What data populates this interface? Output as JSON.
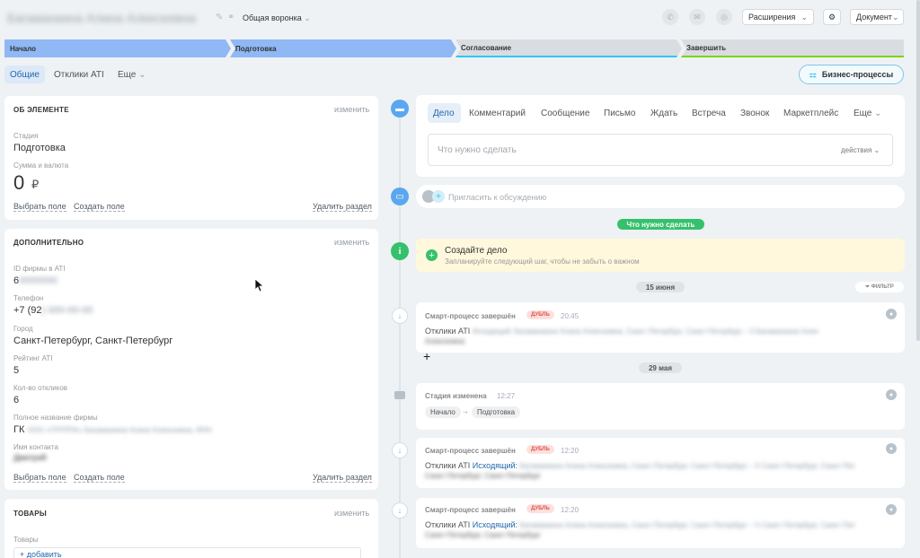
{
  "header": {
    "title": "Багаманкина Алина Алексеевна",
    "pipeline": "Общая воронка",
    "ext_btn": "Расширения",
    "doc_btn": "Документ"
  },
  "stages": [
    "Начало",
    "Подготовка",
    "Согласование",
    "Завершить"
  ],
  "tabs": {
    "general": "Общие",
    "ati": "Отклики ATI",
    "more": "Еще"
  },
  "bp_btn": "Бизнес-процессы",
  "about": {
    "title": "ОБ ЭЛЕМЕНТЕ",
    "change": "изменить",
    "stage_label": "Стадия",
    "stage_value": "Подготовка",
    "sum_label": "Сумма и валюта",
    "sum_value": "0",
    "currency": "₽",
    "pick": "Выбрать поле",
    "create": "Создать поле",
    "delete": "Удалить раздел"
  },
  "extra": {
    "title": "ДОПОЛНИТЕЛЬНО",
    "change": "изменить",
    "f1_label": "ID фирмы в ATI",
    "f1_value": "6",
    "f1_blur": "0000000",
    "f2_label": "Телефон",
    "f2_value": "+7 (92",
    "f2_blur": ") 000-00-00",
    "f3_label": "Город",
    "f3_value": "Санкт-Петербург, Санкт-Петербург",
    "f4_label": "Рейтинг ATI",
    "f4_value": "5",
    "f5_label": "Кол-во откликов",
    "f5_value": "6",
    "f6_label": "Полное название фирмы",
    "f6_value": "ГК",
    "f6_blur": "ООО «ГРУППА» Багаманкина Алина Алексеевна, ИНН",
    "f7_label": "Имя контакта",
    "f7_blur": "Дмитрий",
    "pick": "Выбрать поле",
    "create": "Создать поле",
    "delete": "Удалить раздел"
  },
  "goods": {
    "title": "ТОВАРЫ",
    "change": "изменить",
    "label": "Товары",
    "add": "+ добавить"
  },
  "composer": {
    "tabs": [
      "Дело",
      "Комментарий",
      "Сообщение",
      "Письмо",
      "Ждать",
      "Встреча",
      "Звонок",
      "Маркетплейс",
      "Еще"
    ],
    "placeholder": "Что нужно сделать",
    "actions": "действия"
  },
  "invite": "Пригласить к обсуждению",
  "todo_pill": "Что нужно сделать",
  "create_task": {
    "title": "Создайте дело",
    "sub": "Запланируйте следующий шаг, чтобы не забыть о важном"
  },
  "date1": "15 июня",
  "filter": "ФИЛЬТР",
  "date2": "29 мая",
  "events": {
    "e1": {
      "title": "Смарт-процесс завершён",
      "badge": "ДУБЛЬ",
      "time": "20:45",
      "text": "Отклики ATI",
      "blur1": "Исходящий: Багаманкина Алина Алексеевна, Санкт-Петербург, Санкт-Петербург – 5 Багаманкина Ален",
      "blur2": "Алексеевна"
    },
    "e2": {
      "title": "Стадия изменена",
      "time": "12:27",
      "from": "Начало",
      "to": "Подготовка"
    },
    "e3": {
      "title": "Смарт-процесс завершён",
      "badge": "ДУБЛЬ",
      "time": "12:20",
      "text": "Отклики ATI",
      "link": "Исходящий:",
      "blur1": "Багаманкина Алина Алексеевна, Санкт-Петербург, Санкт-Петербург – 5 Санкт-Петербург, Санкт-Пет",
      "blur2": "Санкт-Петербург, Санкт-Петербург"
    },
    "e4": {
      "title": "Смарт-процесс завершён",
      "badge": "ДУБЛЬ",
      "time": "12:20",
      "text": "Отклики ATI",
      "link": "Исходящий:",
      "blur1": "Багаманкина Алина Алексеевна, Санкт-Петербург, Санкт-Петербург – 5 Санкт-Петербург, Санкт-Пет",
      "blur2": "Санкт-Петербург, Санкт-Петербург"
    }
  },
  "colors": {
    "stage_done": "#8fb8f5",
    "stage_pending": "#d9dde1",
    "accent": "#2fc6f6",
    "green": "#35c16b"
  }
}
